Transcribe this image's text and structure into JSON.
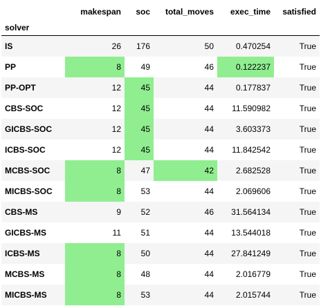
{
  "table": {
    "index_name": "solver",
    "columns": [
      "makespan",
      "soc",
      "total_moves",
      "exec_time",
      "satisfied"
    ],
    "rows": [
      {
        "solver": "IS",
        "values": [
          "26",
          "176",
          "50",
          "0.470254",
          "True"
        ],
        "highlight": []
      },
      {
        "solver": "PP",
        "values": [
          "8",
          "49",
          "46",
          "0.122237",
          "True"
        ],
        "highlight": [
          0,
          3
        ]
      },
      {
        "solver": "PP-OPT",
        "values": [
          "12",
          "45",
          "44",
          "0.177837",
          "True"
        ],
        "highlight": [
          1
        ]
      },
      {
        "solver": "CBS-SOC",
        "values": [
          "12",
          "45",
          "44",
          "11.590982",
          "True"
        ],
        "highlight": [
          1
        ]
      },
      {
        "solver": "GICBS-SOC",
        "values": [
          "12",
          "45",
          "44",
          "3.603373",
          "True"
        ],
        "highlight": [
          1
        ]
      },
      {
        "solver": "ICBS-SOC",
        "values": [
          "12",
          "45",
          "44",
          "11.842542",
          "True"
        ],
        "highlight": [
          1
        ]
      },
      {
        "solver": "MCBS-SOC",
        "values": [
          "8",
          "47",
          "42",
          "2.682528",
          "True"
        ],
        "highlight": [
          0,
          2
        ]
      },
      {
        "solver": "MICBS-SOC",
        "values": [
          "8",
          "53",
          "44",
          "2.069606",
          "True"
        ],
        "highlight": [
          0
        ]
      },
      {
        "solver": "CBS-MS",
        "values": [
          "9",
          "52",
          "46",
          "31.564134",
          "True"
        ],
        "highlight": []
      },
      {
        "solver": "GICBS-MS",
        "values": [
          "11",
          "51",
          "44",
          "13.544018",
          "True"
        ],
        "highlight": []
      },
      {
        "solver": "ICBS-MS",
        "values": [
          "8",
          "50",
          "44",
          "27.841249",
          "True"
        ],
        "highlight": [
          0
        ]
      },
      {
        "solver": "MCBS-MS",
        "values": [
          "8",
          "48",
          "44",
          "2.016779",
          "True"
        ],
        "highlight": [
          0
        ]
      },
      {
        "solver": "MICBS-MS",
        "values": [
          "8",
          "53",
          "44",
          "2.015744",
          "True"
        ],
        "highlight": [
          0
        ]
      }
    ]
  },
  "colors": {
    "highlight": "#90ee90",
    "stripe": "#f5f5f5"
  }
}
